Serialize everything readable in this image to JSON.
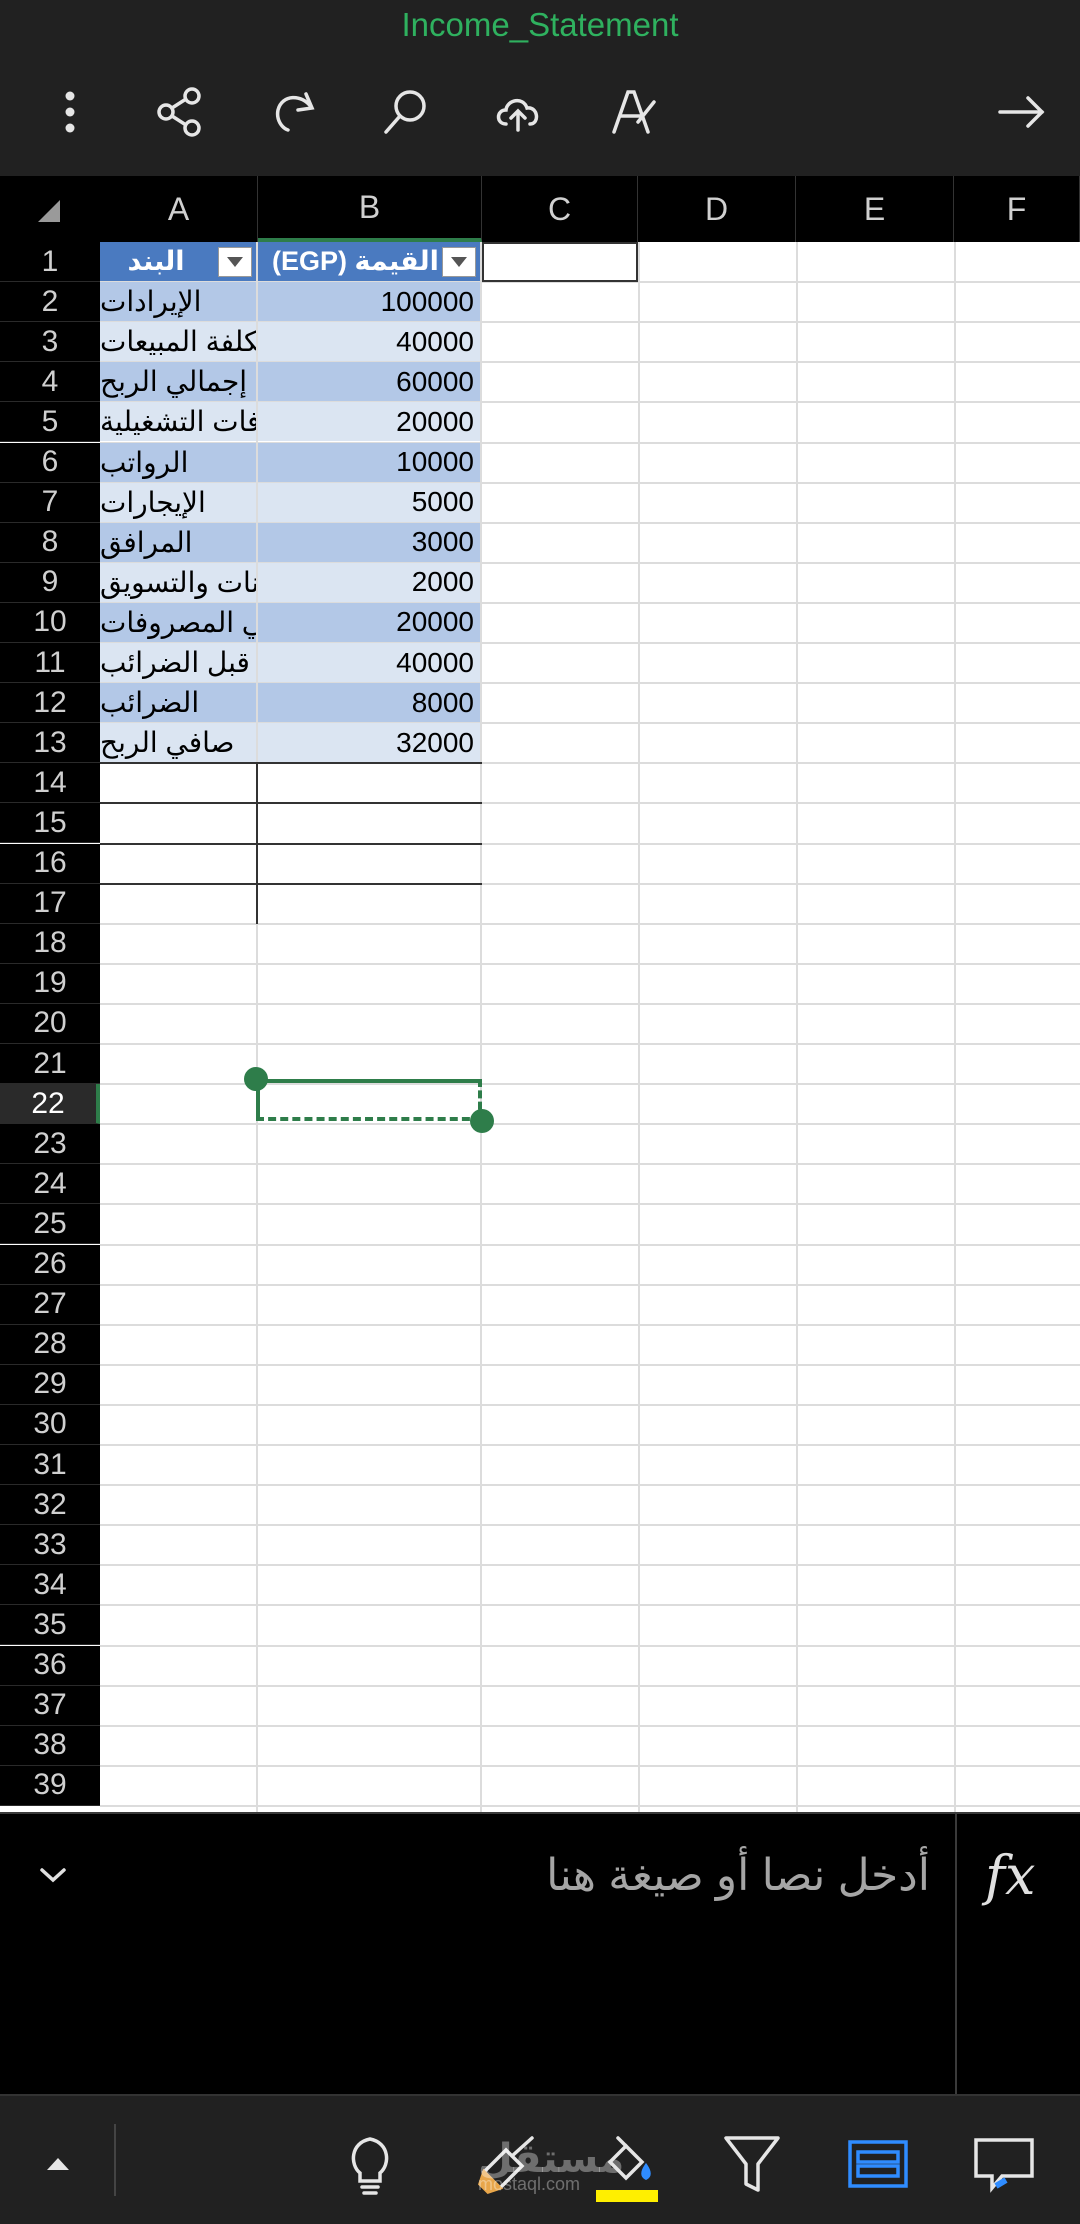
{
  "title": "Income_Statement",
  "columns": [
    "A",
    "B",
    "C",
    "D",
    "E",
    "F"
  ],
  "rows": [
    "1",
    "2",
    "3",
    "4",
    "5",
    "6",
    "7",
    "8",
    "9",
    "10",
    "11",
    "12",
    "13",
    "14",
    "15",
    "16",
    "17",
    "18",
    "19",
    "20",
    "21",
    "22",
    "23",
    "24",
    "25",
    "26",
    "27",
    "28",
    "29",
    "30",
    "31",
    "32",
    "33",
    "34",
    "35",
    "36",
    "37",
    "38",
    "39"
  ],
  "table": {
    "header": {
      "a": "البند",
      "b": "القيمة (EGP)"
    },
    "rows": [
      {
        "a": "الإيرادات",
        "b": "100000"
      },
      {
        "a": "تكلفة المبيعات",
        "b": "40000"
      },
      {
        "a": "إجمالي الربح",
        "b": "60000"
      },
      {
        "a": "المصروفات التشغيلية",
        "b": "20000"
      },
      {
        "a": "الرواتب",
        "b": "10000"
      },
      {
        "a": "الإيجارات",
        "b": "5000"
      },
      {
        "a": "المرافق",
        "b": "3000"
      },
      {
        "a": "الإعلانات والتسويق",
        "b": "2000"
      },
      {
        "a": "إجمالي المصروفات",
        "b": "20000"
      },
      {
        "a": "صافي الربح قبل الضرائب",
        "b": "40000"
      },
      {
        "a": "الضرائب",
        "b": "8000"
      },
      {
        "a": "صافي الربح",
        "b": "32000"
      }
    ]
  },
  "active_row": "22",
  "formula_bar": {
    "placeholder": "أدخل نصا أو صيغة هنا",
    "fx": "fx"
  },
  "watermark": {
    "text": "مستقل",
    "sub": "mostaql.com"
  },
  "icons": {
    "top": [
      "more-vertical-icon",
      "share-icon",
      "redo-icon",
      "search-icon",
      "cloud-upload-icon",
      "draw-pen-icon",
      "forward-arrow-icon"
    ],
    "bottom": [
      "expand-up-icon",
      "lightbulb-icon",
      "format-brush-icon",
      "fill-color-icon",
      "filter-icon",
      "table-style-icon",
      "comment-icon"
    ]
  },
  "colors": {
    "accent": "#2e7d4a",
    "title": "#2fb15f",
    "table_header": "#4a7ac0",
    "band_dark": "#b3c8e7",
    "band_light": "#dbe5f2",
    "highlight": "#ffef00"
  }
}
